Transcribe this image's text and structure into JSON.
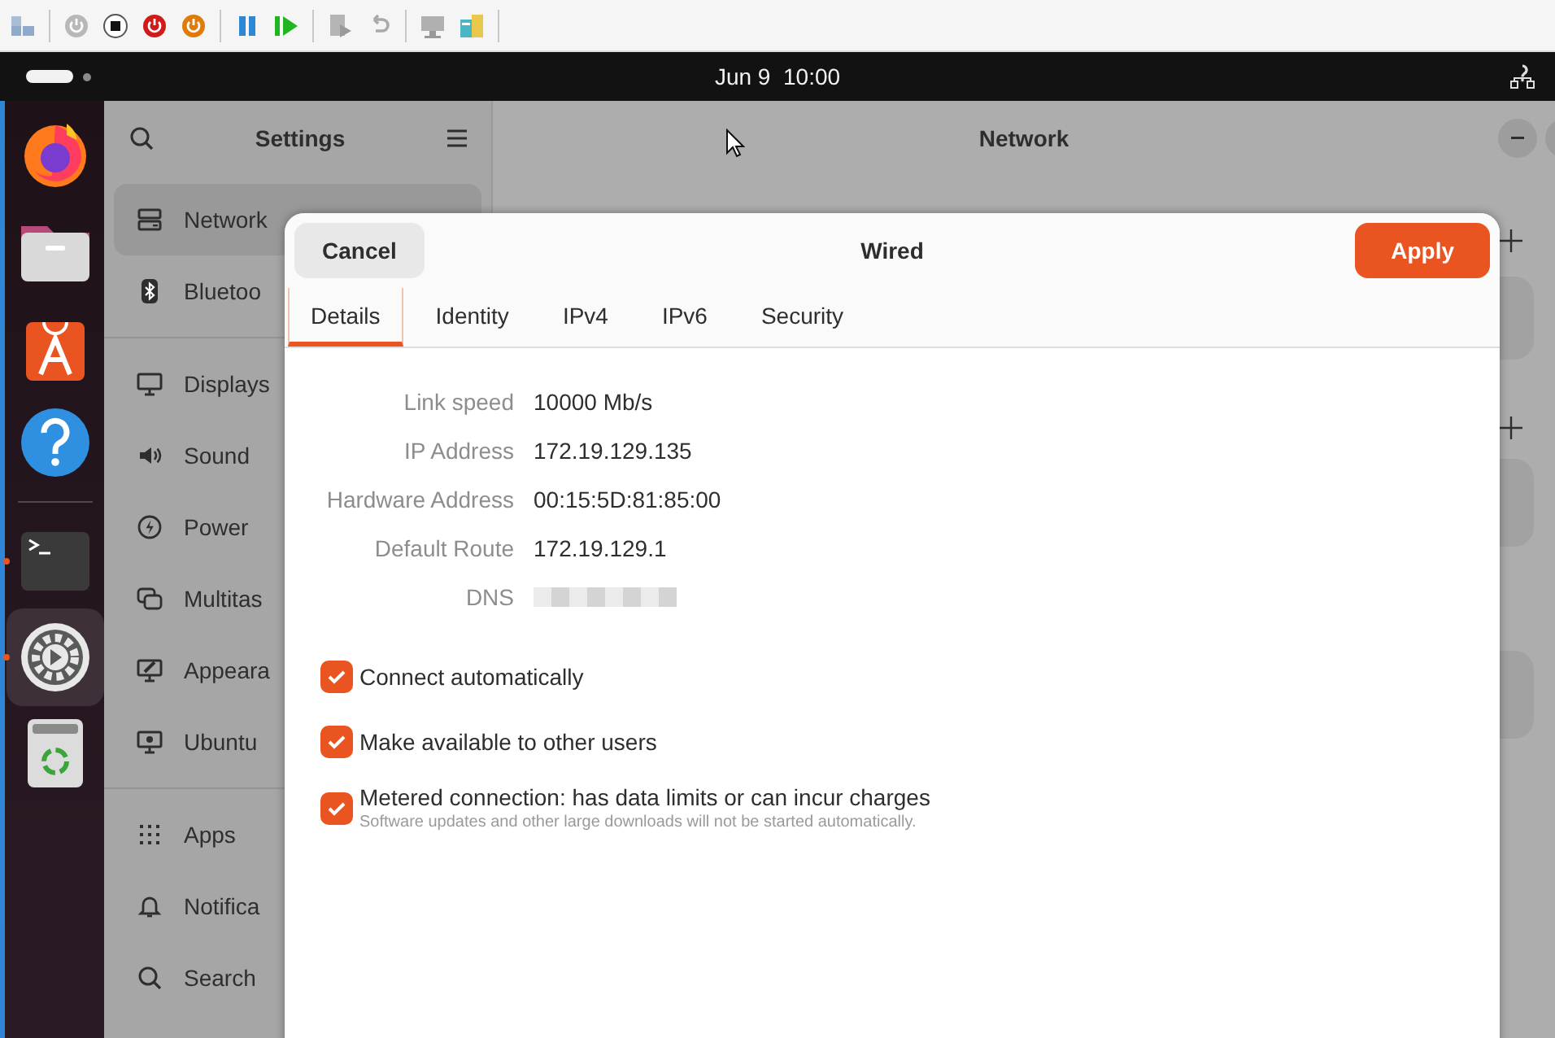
{
  "top_bar": {
    "clock": "Jun 9  10:00"
  },
  "dock": {
    "items": [
      {
        "kind": "browser",
        "running": false,
        "selected": false
      },
      {
        "kind": "files",
        "running": false,
        "selected": false
      },
      {
        "kind": "store",
        "running": false,
        "selected": false
      },
      {
        "kind": "help",
        "running": false,
        "selected": false
      },
      {
        "kind": "separator"
      },
      {
        "kind": "terminal",
        "running": true,
        "selected": false
      },
      {
        "kind": "settings",
        "running": true,
        "selected": true
      },
      {
        "kind": "trash",
        "running": false,
        "selected": false
      }
    ]
  },
  "settings": {
    "title": "Settings",
    "page_title": "Network",
    "sidebar": {
      "groups": [
        [
          {
            "kind": "network",
            "label": "Network",
            "selected": true
          },
          {
            "kind": "bluetooth",
            "label": "Bluetoo",
            "selected": false
          }
        ],
        [
          {
            "kind": "display",
            "label": "Displays",
            "selected": false
          },
          {
            "kind": "sound",
            "label": "Sound",
            "selected": false
          },
          {
            "kind": "power",
            "label": "Power",
            "selected": false
          },
          {
            "kind": "multitasking",
            "label": "Multitas",
            "selected": false
          },
          {
            "kind": "appearance",
            "label": "Appeara",
            "selected": false
          },
          {
            "kind": "desktop",
            "label": "Ubuntu",
            "selected": false
          }
        ],
        [
          {
            "kind": "apps",
            "label": "Apps",
            "selected": false
          },
          {
            "kind": "notifications",
            "label": "Notifica",
            "selected": false
          },
          {
            "kind": "search",
            "label": "Search",
            "selected": false
          }
        ]
      ]
    }
  },
  "dialog": {
    "title": "Wired",
    "cancel": "Cancel",
    "apply": "Apply",
    "tabs": [
      {
        "label": "Details",
        "selected": true
      },
      {
        "label": "Identity",
        "selected": false
      },
      {
        "label": "IPv4",
        "selected": false
      },
      {
        "label": "IPv6",
        "selected": false
      },
      {
        "label": "Security",
        "selected": false
      }
    ],
    "details": [
      {
        "label": "Link speed",
        "value": "10000 Mb/s"
      },
      {
        "label": "IP Address",
        "value": "172.19.129.135"
      },
      {
        "label": "Hardware Address",
        "value": "00:15:5D:81:85:00"
      },
      {
        "label": "Default Route",
        "value": "172.19.129.1"
      },
      {
        "label": "DNS",
        "redacted": true
      }
    ],
    "options": [
      {
        "label": "Connect automatically",
        "checked": true
      },
      {
        "label": "Make available to other users",
        "checked": true
      },
      {
        "label": "Metered connection: has data limits or can incur charges",
        "note": "Software updates and other large downloads will not be started automatically.",
        "checked": true
      }
    ]
  }
}
